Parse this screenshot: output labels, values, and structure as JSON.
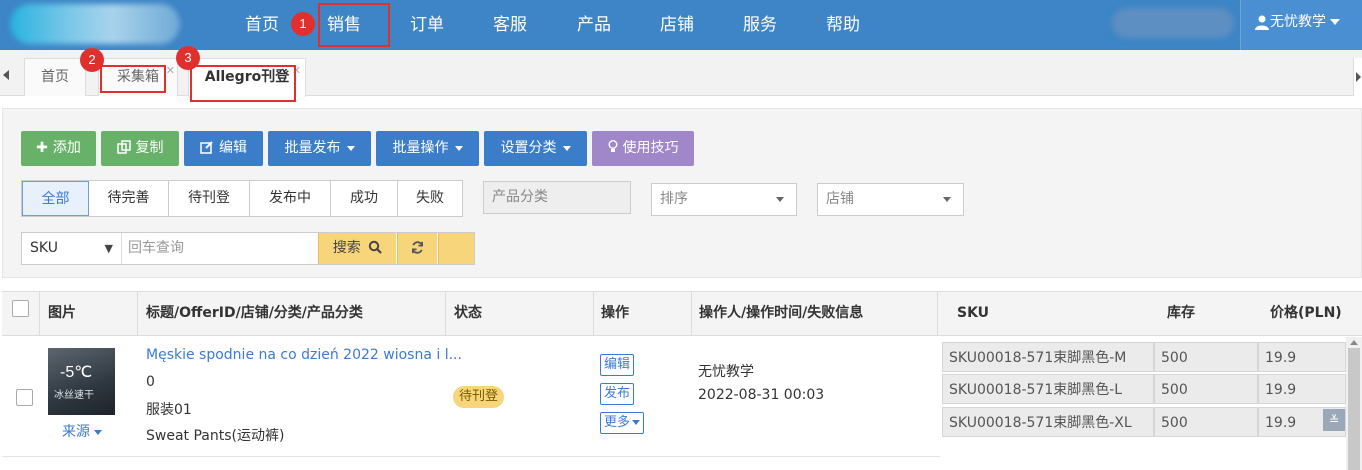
{
  "nav": {
    "items": [
      "首页",
      "销售",
      "订单",
      "客服",
      "产品",
      "店铺",
      "服务",
      "帮助"
    ],
    "user_label": "无忧教学"
  },
  "markers": [
    "1",
    "2",
    "3"
  ],
  "tabs": [
    {
      "label": "首页",
      "active": false
    },
    {
      "label": "采集箱",
      "active": false
    },
    {
      "label": "Allegro刊登",
      "active": true
    }
  ],
  "toolbar": {
    "add": "添加",
    "copy": "复制",
    "edit": "编辑",
    "batch_publish": "批量发布",
    "batch_ops": "批量操作",
    "set_category": "设置分类",
    "tips": "使用技巧"
  },
  "filters": [
    "全部",
    "待完善",
    "待刊登",
    "发布中",
    "成功",
    "失败"
  ],
  "fields": {
    "product_category": "产品分类",
    "sort": "排序",
    "store": "店铺"
  },
  "search": {
    "type": "SKU",
    "placeholder": "回车查询",
    "button": "搜索"
  },
  "table": {
    "headers": {
      "image": "图片",
      "title": "标题/OfferID/店铺/分类/产品分类",
      "status": "状态",
      "ops": "操作",
      "operator": "操作人/操作时间/失败信息",
      "sku": "SKU",
      "stock": "库存",
      "price": "价格(PLN)"
    },
    "row": {
      "thumb_temp": "-5℃",
      "thumb_caption": "冰丝速干",
      "title": "Męskie spodnie na co dzień 2022 wiosna i l...",
      "offer_id": "0",
      "store": "服装01",
      "category": "Sweat Pants(运动裤)",
      "source": "来源",
      "status": "待刊登",
      "ops": [
        "编辑",
        "发布",
        "更多"
      ],
      "operator": "无忧教学",
      "time": "2022-08-31 00:03",
      "skus": [
        {
          "sku": "SKU00018-571束脚黑色-M",
          "stock": "500",
          "price": "19.9"
        },
        {
          "sku": "SKU00018-571束脚黑色-L",
          "stock": "500",
          "price": "19.9"
        },
        {
          "sku": "SKU00018-571束脚黑色-XL",
          "stock": "500",
          "price": "19.9"
        }
      ]
    }
  },
  "colors": {
    "topbar": "#3d85c6",
    "marker": "#e0302e",
    "green_btn": "#67b168",
    "blue_btn": "#3b7dc8",
    "purple_btn": "#a087c9",
    "search_btn": "#f7d57a",
    "link": "#3a7bd5"
  },
  "icons": {
    "add": "plus-icon",
    "copy": "copy-icon",
    "edit": "edit-icon",
    "tips": "lightbulb-icon",
    "search": "search-icon",
    "refresh": "refresh-icon",
    "user": "user-icon"
  }
}
